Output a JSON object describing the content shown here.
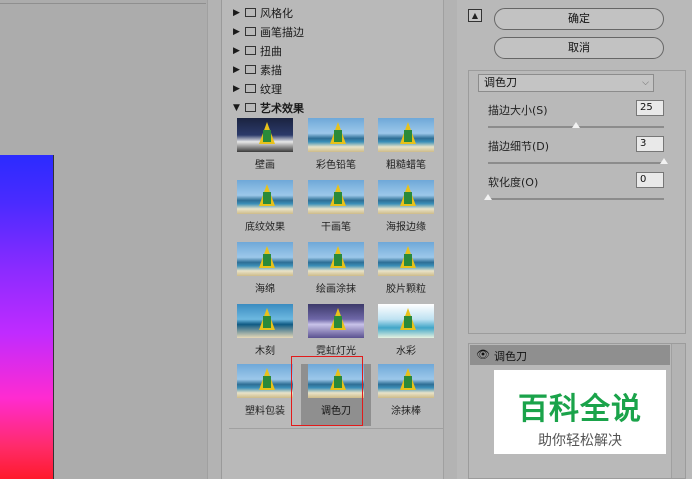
{
  "gallery": {
    "tree": [
      {
        "label": "风格化",
        "expanded": false
      },
      {
        "label": "画笔描边",
        "expanded": false
      },
      {
        "label": "扭曲",
        "expanded": false
      },
      {
        "label": "素描",
        "expanded": false
      },
      {
        "label": "纹理",
        "expanded": false
      },
      {
        "label": "艺术效果",
        "expanded": true
      }
    ],
    "filters": [
      {
        "label": "壁画",
        "style": "dark"
      },
      {
        "label": "彩色铅笔",
        "style": ""
      },
      {
        "label": "粗糙蜡笔",
        "style": ""
      },
      {
        "label": "底纹效果",
        "style": ""
      },
      {
        "label": "干画笔",
        "style": ""
      },
      {
        "label": "海报边缘",
        "style": ""
      },
      {
        "label": "海绵",
        "style": ""
      },
      {
        "label": "绘画涂抹",
        "style": ""
      },
      {
        "label": "胶片颗粒",
        "style": ""
      },
      {
        "label": "木刻",
        "style": "wood"
      },
      {
        "label": "霓虹灯光",
        "style": "neon"
      },
      {
        "label": "水彩",
        "style": "water"
      },
      {
        "label": "塑料包装",
        "style": ""
      },
      {
        "label": "调色刀",
        "style": "",
        "selected": true
      },
      {
        "label": "涂抹棒",
        "style": ""
      }
    ]
  },
  "right": {
    "collapse_icon": "▲",
    "ok_label": "确定",
    "cancel_label": "取消",
    "filter_select": "调色刀",
    "params": [
      {
        "label": "描边大小(S)",
        "value": "25",
        "fraction": 0.5
      },
      {
        "label": "描边细节(D)",
        "value": "3",
        "fraction": 1.0
      },
      {
        "label": "软化度(O)",
        "value": "0",
        "fraction": 0.0
      }
    ],
    "layer_name": "调色刀"
  },
  "watermark": {
    "title": "百科全说",
    "subtitle": "助你轻松解决"
  }
}
